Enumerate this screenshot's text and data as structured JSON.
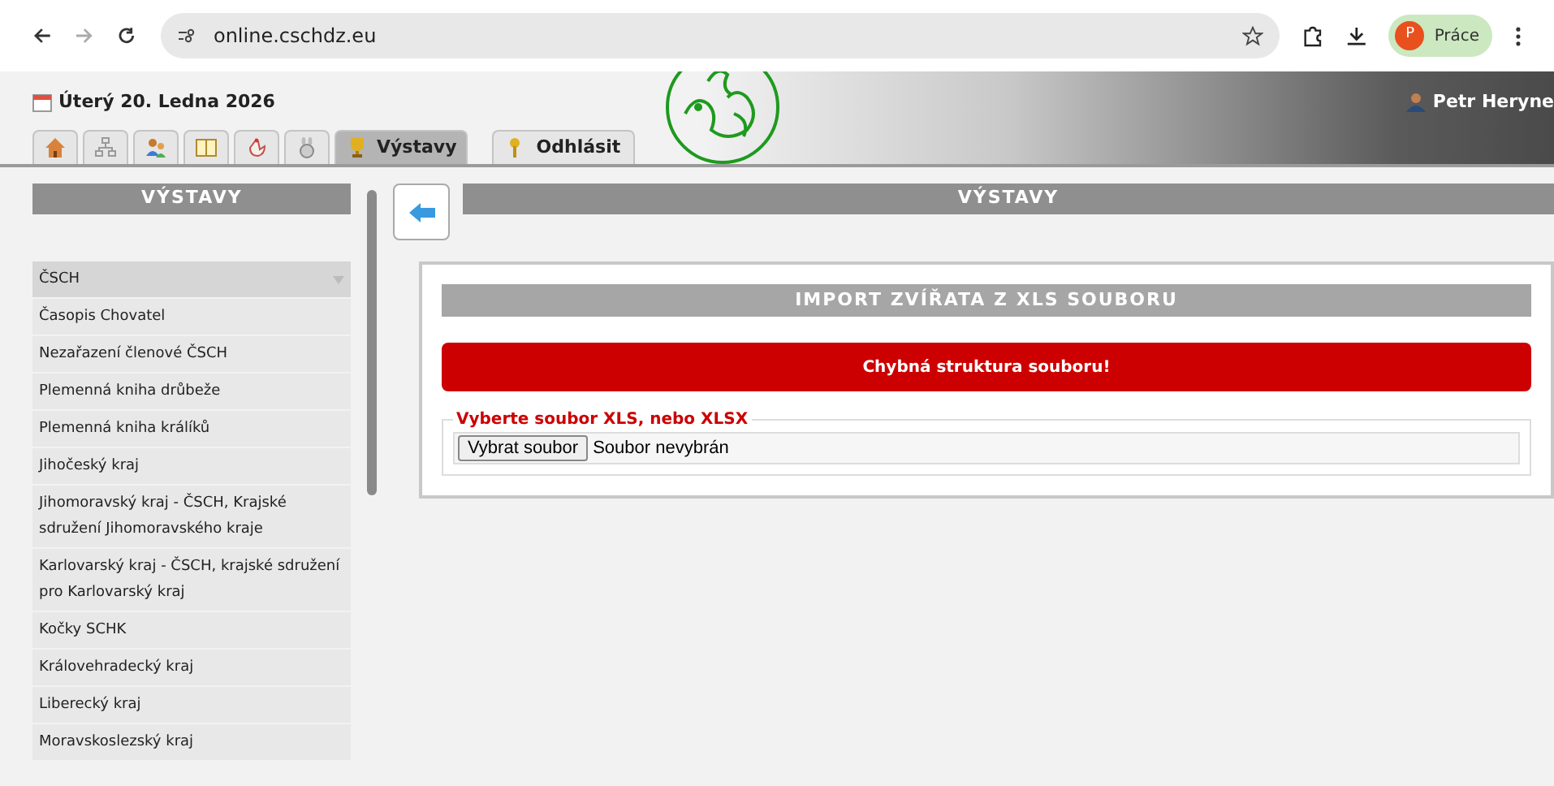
{
  "browser": {
    "url": "online.cschdz.eu",
    "forward_disabled": true,
    "profile_initial": "P",
    "profile_name": "Práce"
  },
  "header": {
    "date": "Úterý 20. Ledna 2026",
    "user": "Petr Heryne"
  },
  "tabs": [
    {
      "selected": false
    },
    {
      "selected": false
    },
    {
      "selected": false
    },
    {
      "selected": false
    },
    {
      "selected": false
    },
    {
      "selected": false
    },
    {
      "label": "Výstavy",
      "selected": true
    }
  ],
  "logout_tab": {
    "label": "Odhlásit"
  },
  "sidebar": {
    "title": "VÝSTAVY",
    "items": [
      {
        "label": "ČSCH",
        "selected": true
      },
      {
        "label": "Časopis Chovatel",
        "selected": false
      },
      {
        "label": "Nezařazení členové ČSCH",
        "selected": false
      },
      {
        "label": "Plemenná kniha drůbeže",
        "selected": false
      },
      {
        "label": "Plemenná kniha králíků",
        "selected": false
      },
      {
        "label": "Jihočeský kraj",
        "selected": false
      },
      {
        "label": "Jihomoravský kraj - ČSCH, Krajské sdružení Jihomoravského kraje",
        "selected": false
      },
      {
        "label": "Karlovarský kraj - ČSCH, krajské sdružení pro Karlovarský kraj",
        "selected": false
      },
      {
        "label": "Kočky SCHK",
        "selected": false
      },
      {
        "label": "Královehradecký kraj",
        "selected": false
      },
      {
        "label": "Liberecký kraj",
        "selected": false
      },
      {
        "label": "Moravskoslezský kraj",
        "selected": false
      }
    ]
  },
  "main": {
    "title": "VÝSTAVY",
    "panel_title": "IMPORT ZVÍŘATA Z XLS SOUBORU",
    "error": "Chybná struktura souboru!",
    "legend": "Vyberte soubor XLS, nebo XLSX",
    "file_button": "Vybrat soubor",
    "file_status": "Soubor nevybrán"
  }
}
